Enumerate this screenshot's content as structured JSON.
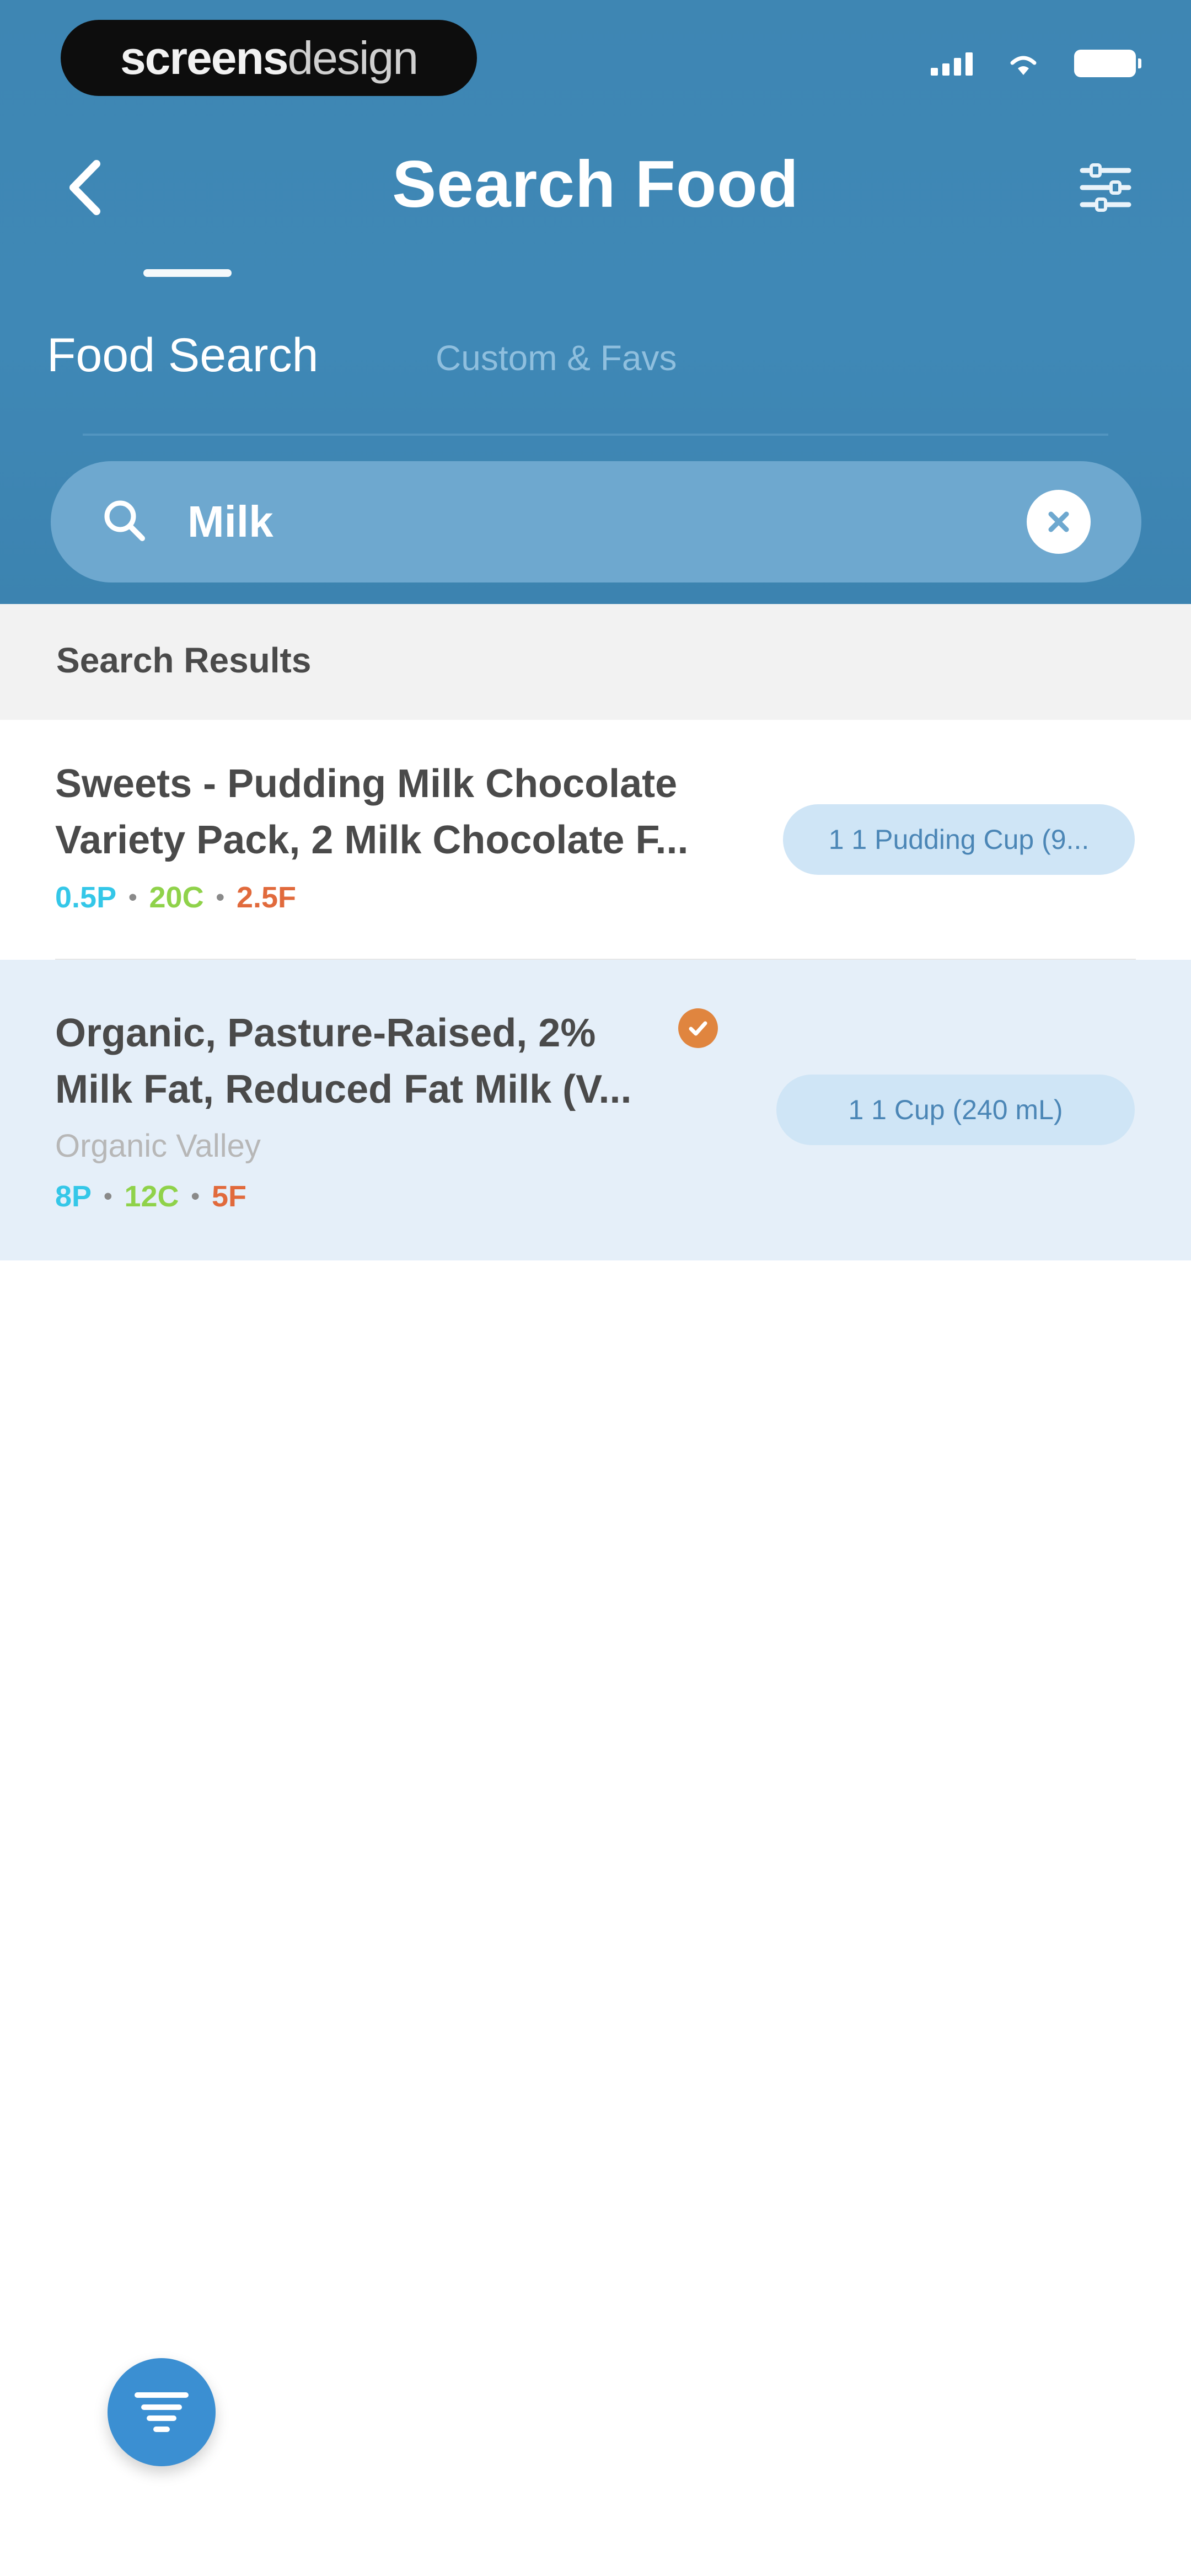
{
  "status_bar": {
    "brand_bold": "screens",
    "brand_light": "design",
    "icons": [
      "cellular-signal-icon",
      "wifi-icon",
      "battery-icon"
    ]
  },
  "header": {
    "back_icon": "chevron-left-icon",
    "title": "Search Food",
    "filter_icon": "sliders-icon",
    "tabs": [
      {
        "label": "Food Search",
        "active": true
      },
      {
        "label": "Custom & Favs",
        "active": false
      }
    ]
  },
  "search": {
    "value": "Milk",
    "placeholder": "",
    "search_icon": "search-icon",
    "clear_icon": "clear-circle-icon"
  },
  "results": {
    "section_title": "Search Results",
    "items": [
      {
        "name_line1": "Sweets - Pudding Milk Chocolate",
        "name_line2": "Variety Pack, 2 Milk Chocolate F...",
        "brand": "",
        "macros": {
          "protein": "0.5P",
          "carbs": "20C",
          "fat": "2.5F"
        },
        "serving": "1 1 Pudding Cup (9...",
        "verified": false,
        "highlighted": false
      },
      {
        "name_line1": "Organic, Pasture-Raised, 2%",
        "name_line2": "Milk Fat, Reduced Fat Milk (V...",
        "brand": "Organic Valley",
        "macros": {
          "protein": "8P",
          "carbs": "12C",
          "fat": "5F"
        },
        "serving": "1 1 Cup (240 mL)",
        "verified": true,
        "highlighted": true
      }
    ]
  },
  "fab": {
    "icon": "filter-icon"
  },
  "colors": {
    "header_blue": "#3e86b3",
    "protein": "#34c7e8",
    "carbs": "#8fd24a",
    "fat": "#e16a3c",
    "fab": "#3b8fd2",
    "verified": "#e0853f"
  }
}
